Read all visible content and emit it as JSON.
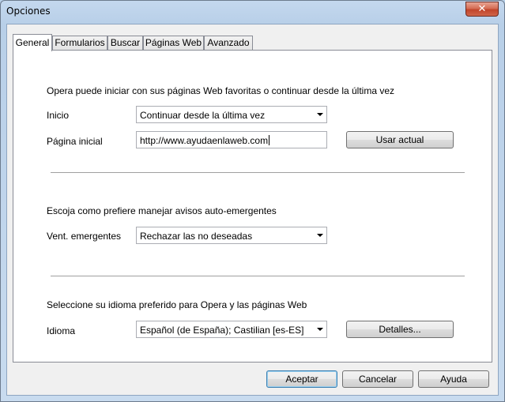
{
  "window": {
    "title": "Opciones",
    "close_symbol": "✕"
  },
  "tabs": [
    {
      "label": "General",
      "active": true
    },
    {
      "label": "Formularios",
      "active": false
    },
    {
      "label": "Buscar",
      "active": false
    },
    {
      "label": "Páginas Web",
      "active": false
    },
    {
      "label": "Avanzado",
      "active": false
    }
  ],
  "startup_section": {
    "description": "Opera puede iniciar con sus páginas Web favoritas o continuar desde la última vez",
    "inicio_label": "Inicio",
    "inicio_value": "Continuar desde la última vez",
    "homepage_label": "Página inicial",
    "homepage_value": "http://www.ayudaenlaweb.com",
    "use_current_button": "Usar actual"
  },
  "popups_section": {
    "description": "Escoja como prefiere manejar avisos auto-emergentes",
    "popups_label": "Vent. emergentes",
    "popups_value": "Rechazar las no deseadas"
  },
  "language_section": {
    "description": "Seleccione su idioma preferido para Opera y las páginas Web",
    "language_label": "Idioma",
    "language_value": "Español (de España); Castilian [es-ES]",
    "details_button": "Detalles..."
  },
  "footer": {
    "accept_button": "Aceptar",
    "cancel_button": "Cancelar",
    "help_button": "Ayuda"
  }
}
